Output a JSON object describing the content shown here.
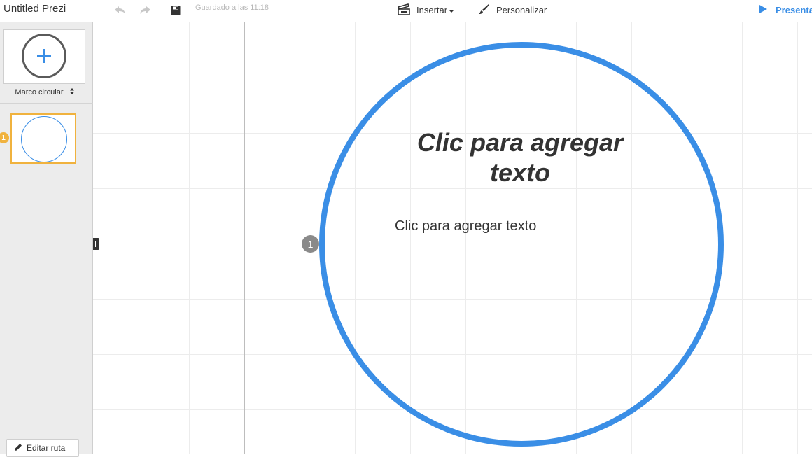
{
  "header": {
    "title": "Untitled Prezi",
    "saved_status": "Guardado a las 11:18",
    "insert_label": "Insertar",
    "customize_label": "Personalizar",
    "present_label": "Presentar",
    "icons": [
      "undo-icon",
      "redo-icon",
      "save-icon",
      "insert-icon",
      "chevron-down-icon",
      "brush-icon",
      "play-icon"
    ]
  },
  "sidebar": {
    "add_frame_icon": "plus-icon",
    "frame_type": "Marco circular",
    "thumbnails": [
      {
        "number": "1"
      }
    ],
    "edit_path_label": "Editar ruta"
  },
  "canvas": {
    "frame_title_line1": "Clic para agregar",
    "frame_title_line2": "texto",
    "frame_body": "Clic para agregar texto",
    "path_number": "1"
  },
  "colors": {
    "accent": "#3a8ee6",
    "selection": "#f0b23e",
    "badge_gray": "#8a8a8a"
  }
}
